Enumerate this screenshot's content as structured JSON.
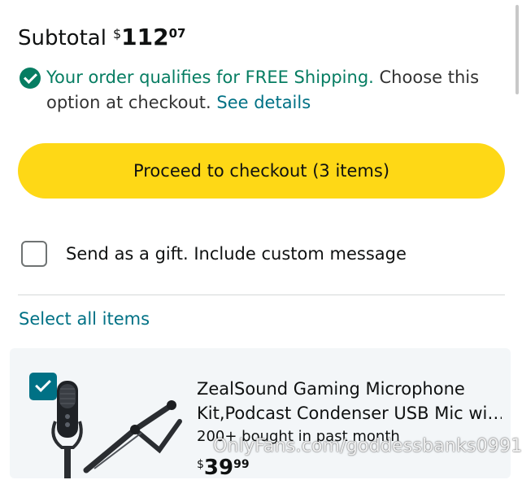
{
  "subtotal": {
    "label": "Subtotal",
    "currency": "$",
    "whole": "112",
    "fraction": "07"
  },
  "shipping": {
    "qualifies_text": "Your order qualifies for FREE Shipping.",
    "choose_text": " Choose this option at checkout.",
    "details_link": "See details",
    "icon": "check-circle-icon"
  },
  "checkout": {
    "button_label": "Proceed to checkout (3 items)"
  },
  "gift": {
    "label": "Send as a gift. Include custom message",
    "checked": false
  },
  "select_all": {
    "label": "Select all items"
  },
  "items": [
    {
      "title_line1": "ZealSound Gaming Microphone",
      "title_line2": "Kit,Podcast Condenser USB Mic wi…",
      "bought": "200+ bought in past month",
      "price_currency": "$",
      "price_whole": "39",
      "price_fraction": "99",
      "checked": true,
      "image_icon": "microphone-boom-arm-image"
    }
  ],
  "watermark": {
    "text": "OnlyFans.com/goddessbanks0991"
  },
  "colors": {
    "button_yellow": "#fed816",
    "link_teal": "#007185",
    "success_green": "#067d62"
  }
}
